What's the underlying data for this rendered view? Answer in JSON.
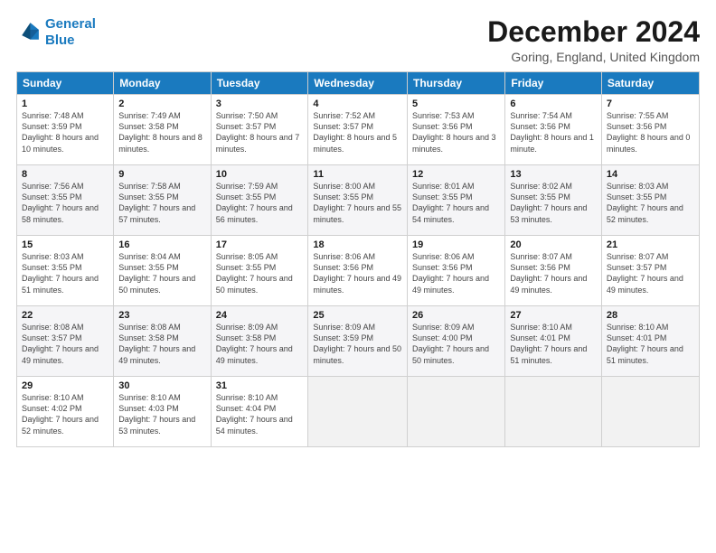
{
  "logo": {
    "line1": "General",
    "line2": "Blue"
  },
  "title": "December 2024",
  "subtitle": "Goring, England, United Kingdom",
  "days_of_week": [
    "Sunday",
    "Monday",
    "Tuesday",
    "Wednesday",
    "Thursday",
    "Friday",
    "Saturday"
  ],
  "weeks": [
    [
      {
        "day": "1",
        "sunrise": "7:48 AM",
        "sunset": "3:59 PM",
        "daylight": "8 hours and 10 minutes."
      },
      {
        "day": "2",
        "sunrise": "7:49 AM",
        "sunset": "3:58 PM",
        "daylight": "8 hours and 8 minutes."
      },
      {
        "day": "3",
        "sunrise": "7:50 AM",
        "sunset": "3:57 PM",
        "daylight": "8 hours and 7 minutes."
      },
      {
        "day": "4",
        "sunrise": "7:52 AM",
        "sunset": "3:57 PM",
        "daylight": "8 hours and 5 minutes."
      },
      {
        "day": "5",
        "sunrise": "7:53 AM",
        "sunset": "3:56 PM",
        "daylight": "8 hours and 3 minutes."
      },
      {
        "day": "6",
        "sunrise": "7:54 AM",
        "sunset": "3:56 PM",
        "daylight": "8 hours and 1 minute."
      },
      {
        "day": "7",
        "sunrise": "7:55 AM",
        "sunset": "3:56 PM",
        "daylight": "8 hours and 0 minutes."
      }
    ],
    [
      {
        "day": "8",
        "sunrise": "7:56 AM",
        "sunset": "3:55 PM",
        "daylight": "7 hours and 58 minutes."
      },
      {
        "day": "9",
        "sunrise": "7:58 AM",
        "sunset": "3:55 PM",
        "daylight": "7 hours and 57 minutes."
      },
      {
        "day": "10",
        "sunrise": "7:59 AM",
        "sunset": "3:55 PM",
        "daylight": "7 hours and 56 minutes."
      },
      {
        "day": "11",
        "sunrise": "8:00 AM",
        "sunset": "3:55 PM",
        "daylight": "7 hours and 55 minutes."
      },
      {
        "day": "12",
        "sunrise": "8:01 AM",
        "sunset": "3:55 PM",
        "daylight": "7 hours and 54 minutes."
      },
      {
        "day": "13",
        "sunrise": "8:02 AM",
        "sunset": "3:55 PM",
        "daylight": "7 hours and 53 minutes."
      },
      {
        "day": "14",
        "sunrise": "8:03 AM",
        "sunset": "3:55 PM",
        "daylight": "7 hours and 52 minutes."
      }
    ],
    [
      {
        "day": "15",
        "sunrise": "8:03 AM",
        "sunset": "3:55 PM",
        "daylight": "7 hours and 51 minutes."
      },
      {
        "day": "16",
        "sunrise": "8:04 AM",
        "sunset": "3:55 PM",
        "daylight": "7 hours and 50 minutes."
      },
      {
        "day": "17",
        "sunrise": "8:05 AM",
        "sunset": "3:55 PM",
        "daylight": "7 hours and 50 minutes."
      },
      {
        "day": "18",
        "sunrise": "8:06 AM",
        "sunset": "3:56 PM",
        "daylight": "7 hours and 49 minutes."
      },
      {
        "day": "19",
        "sunrise": "8:06 AM",
        "sunset": "3:56 PM",
        "daylight": "7 hours and 49 minutes."
      },
      {
        "day": "20",
        "sunrise": "8:07 AM",
        "sunset": "3:56 PM",
        "daylight": "7 hours and 49 minutes."
      },
      {
        "day": "21",
        "sunrise": "8:07 AM",
        "sunset": "3:57 PM",
        "daylight": "7 hours and 49 minutes."
      }
    ],
    [
      {
        "day": "22",
        "sunrise": "8:08 AM",
        "sunset": "3:57 PM",
        "daylight": "7 hours and 49 minutes."
      },
      {
        "day": "23",
        "sunrise": "8:08 AM",
        "sunset": "3:58 PM",
        "daylight": "7 hours and 49 minutes."
      },
      {
        "day": "24",
        "sunrise": "8:09 AM",
        "sunset": "3:58 PM",
        "daylight": "7 hours and 49 minutes."
      },
      {
        "day": "25",
        "sunrise": "8:09 AM",
        "sunset": "3:59 PM",
        "daylight": "7 hours and 50 minutes."
      },
      {
        "day": "26",
        "sunrise": "8:09 AM",
        "sunset": "4:00 PM",
        "daylight": "7 hours and 50 minutes."
      },
      {
        "day": "27",
        "sunrise": "8:10 AM",
        "sunset": "4:01 PM",
        "daylight": "7 hours and 51 minutes."
      },
      {
        "day": "28",
        "sunrise": "8:10 AM",
        "sunset": "4:01 PM",
        "daylight": "7 hours and 51 minutes."
      }
    ],
    [
      {
        "day": "29",
        "sunrise": "8:10 AM",
        "sunset": "4:02 PM",
        "daylight": "7 hours and 52 minutes."
      },
      {
        "day": "30",
        "sunrise": "8:10 AM",
        "sunset": "4:03 PM",
        "daylight": "7 hours and 53 minutes."
      },
      {
        "day": "31",
        "sunrise": "8:10 AM",
        "sunset": "4:04 PM",
        "daylight": "7 hours and 54 minutes."
      },
      null,
      null,
      null,
      null
    ]
  ]
}
